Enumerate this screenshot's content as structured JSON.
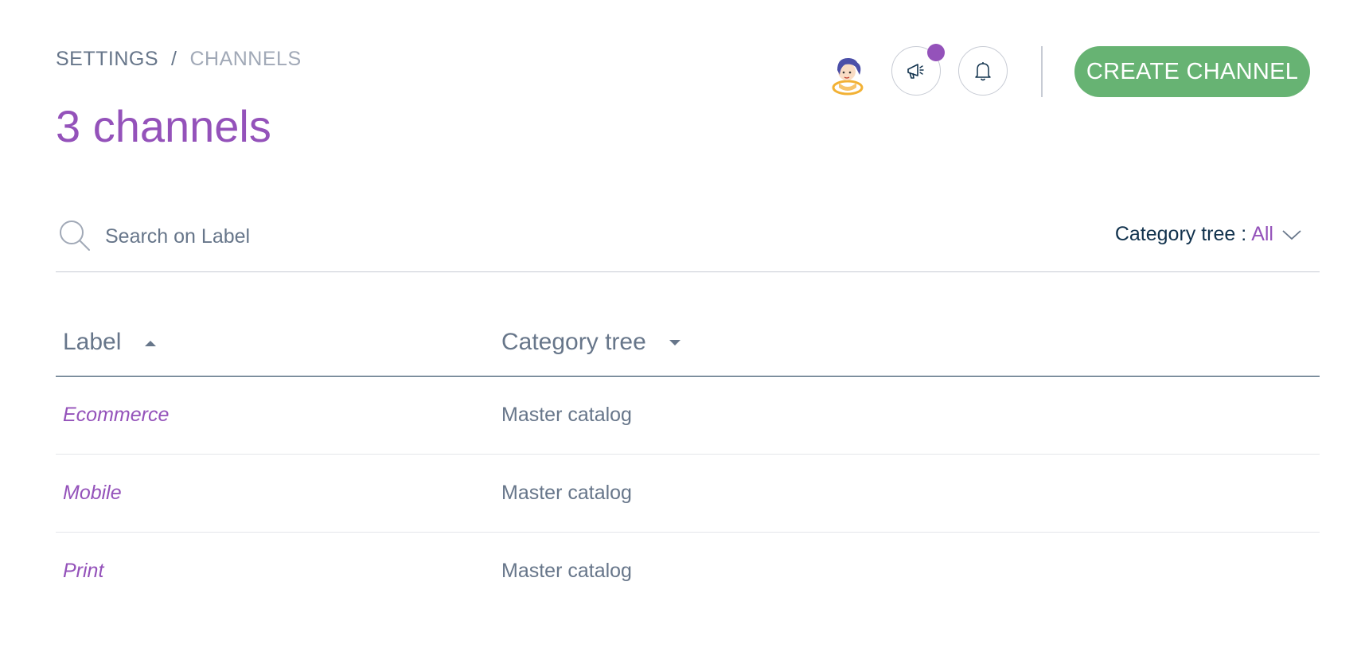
{
  "breadcrumb": {
    "settings": "SETTINGS",
    "separator": "/",
    "current": "CHANNELS"
  },
  "page_title": "3 channels",
  "header": {
    "create_label": "CREATE CHANNEL",
    "accent_color": "#9452ba",
    "create_color": "#67b373"
  },
  "search": {
    "placeholder": "Search on Label",
    "value": ""
  },
  "filter": {
    "label": "Category tree :",
    "value": "All"
  },
  "table": {
    "columns": [
      {
        "label": "Label",
        "sort": "ascending"
      },
      {
        "label": "Category tree",
        "sort": "descending"
      }
    ],
    "rows": [
      {
        "label": "Ecommerce",
        "category_tree": "Master catalog"
      },
      {
        "label": "Mobile",
        "category_tree": "Master catalog"
      },
      {
        "label": "Print",
        "category_tree": "Master catalog"
      }
    ]
  },
  "icons": [
    "avatar",
    "megaphone-icon",
    "bell-icon",
    "search-icon",
    "chevron-down-icon",
    "sort-asc-icon",
    "sort-desc-icon"
  ]
}
